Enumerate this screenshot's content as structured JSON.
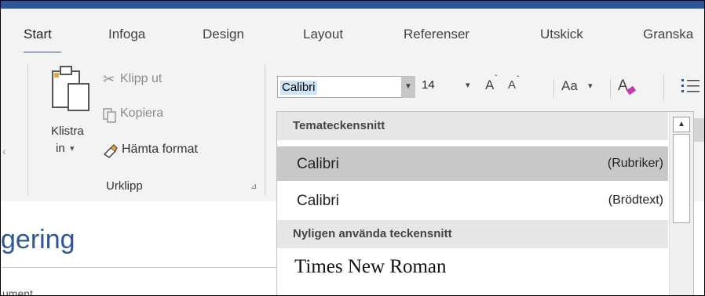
{
  "tabs": [
    "Start",
    "Infoga",
    "Design",
    "Layout",
    "Referenser",
    "Utskick",
    "Granska"
  ],
  "clipboard": {
    "paste_line1": "Klistra",
    "paste_line2": "in",
    "paste_arrow": "▾",
    "cut": "Klipp ut",
    "copy": "Kopiera",
    "format_painter": "Hämta format",
    "group_label": "Urklipp",
    "launcher": "⊿"
  },
  "font": {
    "name": "Calibri",
    "size": "14",
    "dropdown_arrow": "▼",
    "size_arrow": "▾",
    "grow": "A",
    "shrink": "A",
    "case": "Aa",
    "case_arrow": "▾",
    "clear": "A"
  },
  "dropdown": {
    "theme_header": "Temateckensnitt",
    "theme_items": [
      {
        "name": "Calibri",
        "tag": "(Rubriker)"
      },
      {
        "name": "Calibri",
        "tag": "(Brödtext)"
      }
    ],
    "recent_header": "Nyligen använda teckensnitt",
    "recent_items": [
      "Times New Roman"
    ],
    "scroll_up": "▲"
  },
  "document": {
    "heading": "gering",
    "subtext": "ument"
  },
  "colors": {
    "accent": "#2b579a",
    "ribbon_bg": "#f3f3f3",
    "hover": "#c8c8c8",
    "selection": "#cce4f7"
  }
}
